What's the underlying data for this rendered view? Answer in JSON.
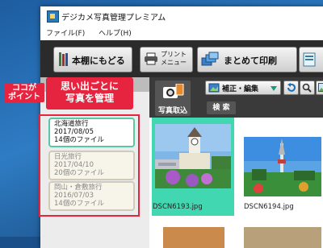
{
  "app": {
    "title": "デジカメ写真管理プレミアム"
  },
  "menu": [
    {
      "label": "ファイル(F)"
    },
    {
      "label": "ヘルプ(H)"
    }
  ],
  "toolbar": {
    "back_label": "本棚にもどる",
    "print_label_line1": "プリント",
    "print_label_line2": "メニュー",
    "batch_print_label": "まとめて印刷"
  },
  "subbar": {
    "import_label": "写真取込",
    "edit_label": "補正・編集",
    "search_label": "検 索"
  },
  "callouts": {
    "point_line1": "ココが",
    "point_line2": "ポイント",
    "main_line1": "思い出ごとに",
    "main_line2": "写真を管理"
  },
  "albums": [
    {
      "name": "北海道旅行",
      "date": "2017/08/05",
      "count": "14個のファイル"
    },
    {
      "name": "日光旅行",
      "date": "2017/04/10",
      "count": "20個のファイル"
    },
    {
      "name": "岡山・倉敷旅行",
      "date": "2016/07/03",
      "count": "14個のファイル"
    }
  ],
  "photos": [
    {
      "filename": "DSCN6193.jpg"
    },
    {
      "filename": "DSCN6194.jpg"
    }
  ],
  "colors": {
    "accent": "#e7243f",
    "selection": "#59c7a3",
    "toolbar": "#2b2b2b"
  }
}
